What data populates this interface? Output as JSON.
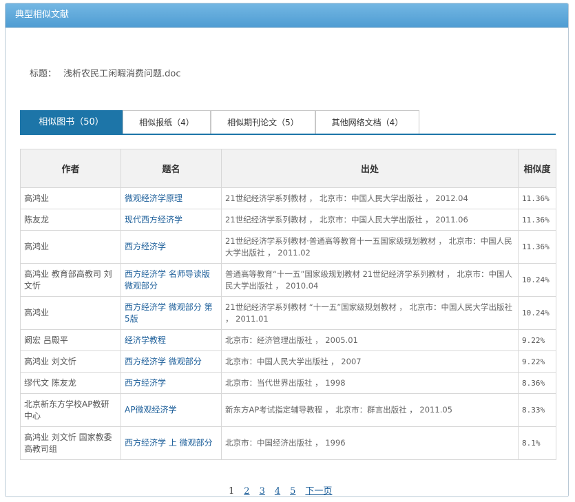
{
  "panel": {
    "title": "典型相似文献"
  },
  "doc": {
    "label": "标题：",
    "name": "浅析农民工闲暇消费问题.doc"
  },
  "tabs": [
    {
      "label": "相似图书（50）"
    },
    {
      "label": "相似报纸（4）"
    },
    {
      "label": "相似期刊论文（5）"
    },
    {
      "label": "其他网络文档（4）"
    }
  ],
  "table": {
    "headers": [
      "作者",
      "题名",
      "出处",
      "相似度"
    ],
    "rows": [
      {
        "author": "高鸿业",
        "title": "微观经济学原理",
        "source": "21世纪经济学系列教材 ， 北京市：中国人民大学出版社 ， 2012.04",
        "sim": "11.36%"
      },
      {
        "author": "陈友龙",
        "title": "现代西方经济学",
        "source": "21世纪经济学系列教材 ， 北京市：中国人民大学出版社 ， 2011.06",
        "sim": "11.36%"
      },
      {
        "author": "高鸿业",
        "title": "西方经济学",
        "source": "21世纪经济学系列教材·普通高等教育十一五国家级规划教材 ， 北京市：中国人民大学出版社 ， 2011.02",
        "sim": "11.36%"
      },
      {
        "author": "高鸿业 教育部高教司 刘文忻",
        "title": "西方经济学 名师导读版 微观部分",
        "source": "普通高等教育“十一五”国家级规划教材 21世纪经济学系列教材 ， 北京市：中国人民大学出版社 ， 2010.04",
        "sim": "10.24%"
      },
      {
        "author": "高鸿业",
        "title": "西方经济学 微观部分 第5版",
        "source": "21世纪经济学系列教材 “十一五”国家级规划教材 ， 北京市：中国人民大学出版社 ， 2011.01",
        "sim": "10.24%"
      },
      {
        "author": "阚宏 吕殿平",
        "title": "经济学教程",
        "source": "北京市：经济管理出版社 ， 2005.01",
        "sim": "9.22%"
      },
      {
        "author": "高鸿业 刘文忻",
        "title": "西方经济学 微观部分",
        "source": "北京市：中国人民大学出版社 ， 2007",
        "sim": "9.22%"
      },
      {
        "author": "缪代文 陈友龙",
        "title": "西方经济学",
        "source": "北京市：当代世界出版社 ， 1998",
        "sim": "8.36%"
      },
      {
        "author": "北京新东方学校AP教研中心",
        "title": "AP微观经济学",
        "source": "新东方AP考试指定辅导教程 ， 北京市：群言出版社 ， 2011.05",
        "sim": "8.33%"
      },
      {
        "author": "高鸿业 刘文忻 国家教委高教司组",
        "title": "西方经济学 上 微观部分",
        "source": "北京市：中国经济出版社 ， 1996",
        "sim": "8.1%"
      }
    ]
  },
  "pager": {
    "current": "1",
    "pages": [
      "2",
      "3",
      "4",
      "5"
    ],
    "next": "下一页"
  }
}
